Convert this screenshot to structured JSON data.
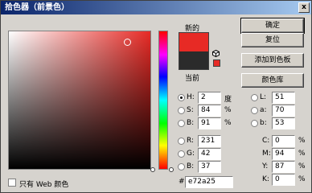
{
  "window": {
    "title": "拾色器（前景色）",
    "close_glyph": "x"
  },
  "swatches": {
    "new_label": "新的",
    "current_label": "当前",
    "new_color": "#e72a25",
    "current_color": "#2b2b2b"
  },
  "buttons": {
    "ok": "确定",
    "reset": "复位",
    "add_to_swatches": "添加到色板",
    "color_libraries": "颜色库"
  },
  "hsb": {
    "h": {
      "label": "H:",
      "value": "2",
      "unit": "度",
      "selected": true
    },
    "s": {
      "label": "S:",
      "value": "84",
      "unit": "%"
    },
    "b": {
      "label": "B:",
      "value": "91",
      "unit": "%"
    }
  },
  "rgb": {
    "r": {
      "label": "R:",
      "value": "231"
    },
    "g": {
      "label": "G:",
      "value": "42"
    },
    "b": {
      "label": "B:",
      "value": "37"
    }
  },
  "lab": {
    "l": {
      "label": "L:",
      "value": "51"
    },
    "a": {
      "label": "a:",
      "value": "70"
    },
    "b": {
      "label": "b:",
      "value": "53"
    }
  },
  "cmyk": {
    "c": {
      "label": "C:",
      "value": "0",
      "unit": "%"
    },
    "m": {
      "label": "M:",
      "value": "94",
      "unit": "%"
    },
    "y": {
      "label": "Y:",
      "value": "87",
      "unit": "%"
    },
    "k": {
      "label": "K:",
      "value": "0",
      "unit": "%"
    }
  },
  "hex": {
    "label": "#",
    "value": "e72a25"
  },
  "web_only": {
    "label": "只有 Web 颜色",
    "checked": false
  }
}
